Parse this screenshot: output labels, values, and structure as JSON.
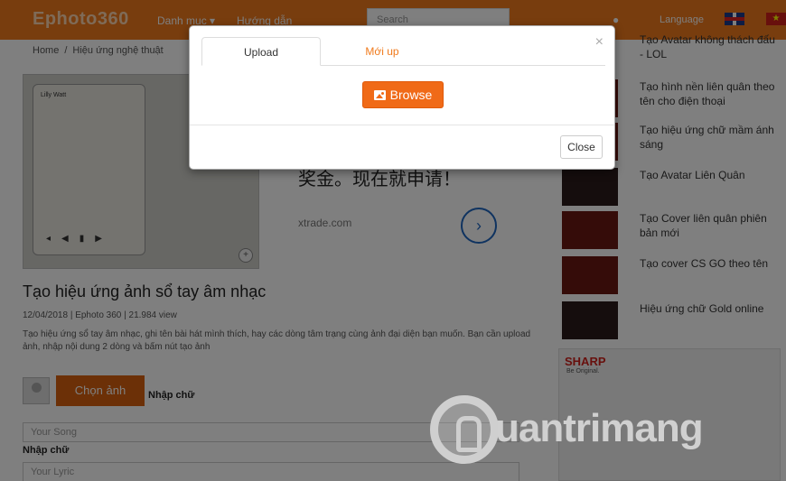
{
  "header": {
    "logo_main": "Ephoto",
    "logo_num": "360",
    "nav": [
      "Danh mục",
      "Hướng dẫn"
    ],
    "search_placeholder": "Search",
    "language_label": "Language"
  },
  "breadcrumb": [
    "Home",
    "Hiệu ứng nghệ thuật"
  ],
  "hero": {
    "phone_title": "Lilly Watt"
  },
  "ad": {
    "text": "奖金。现在就申请！",
    "domain": "xtrade.com"
  },
  "article": {
    "title": "Tạo hiệu ứng ảnh sổ tay âm nhạc",
    "meta": "12/04/2018 | Ephoto 360 | 21.984 view",
    "description": "Tạo hiệu ứng sổ tay âm nhạc, ghi tên bài hát mình thích, hay các dòng tâm trạng cùng ảnh đại diện bạn muốn. Bạn cần upload ảnh, nhập nội dung 2 dòng và bấm nút tạo ảnh"
  },
  "form": {
    "choose_image": "Chọn ảnh",
    "enter_text_label": "Nhập chữ",
    "field1_placeholder": "Your Song",
    "field2_label": "Nhập chữ",
    "field2_placeholder": "Your Lyric"
  },
  "sidebar": {
    "items": [
      "Tạo Avatar không thách đấu - LOL",
      "Tạo hình nền liên quân theo tên cho điện thoại",
      "Tạo hiệu ứng chữ mầm ánh sáng",
      "Tạo Avatar Liên Quân",
      "Tạo Cover liên quân phiên bản mới",
      "Tạo cover CS GO theo tên",
      "Hiệu ứng chữ Gold online"
    ]
  },
  "sharp_ad": {
    "brand": "SHARP",
    "tagline": "Be Original."
  },
  "watermark": "uantrimang",
  "modal": {
    "tabs": [
      "Upload",
      "Mới up"
    ],
    "browse_label": "Browse",
    "close_label": "Close",
    "close_x": "×"
  }
}
